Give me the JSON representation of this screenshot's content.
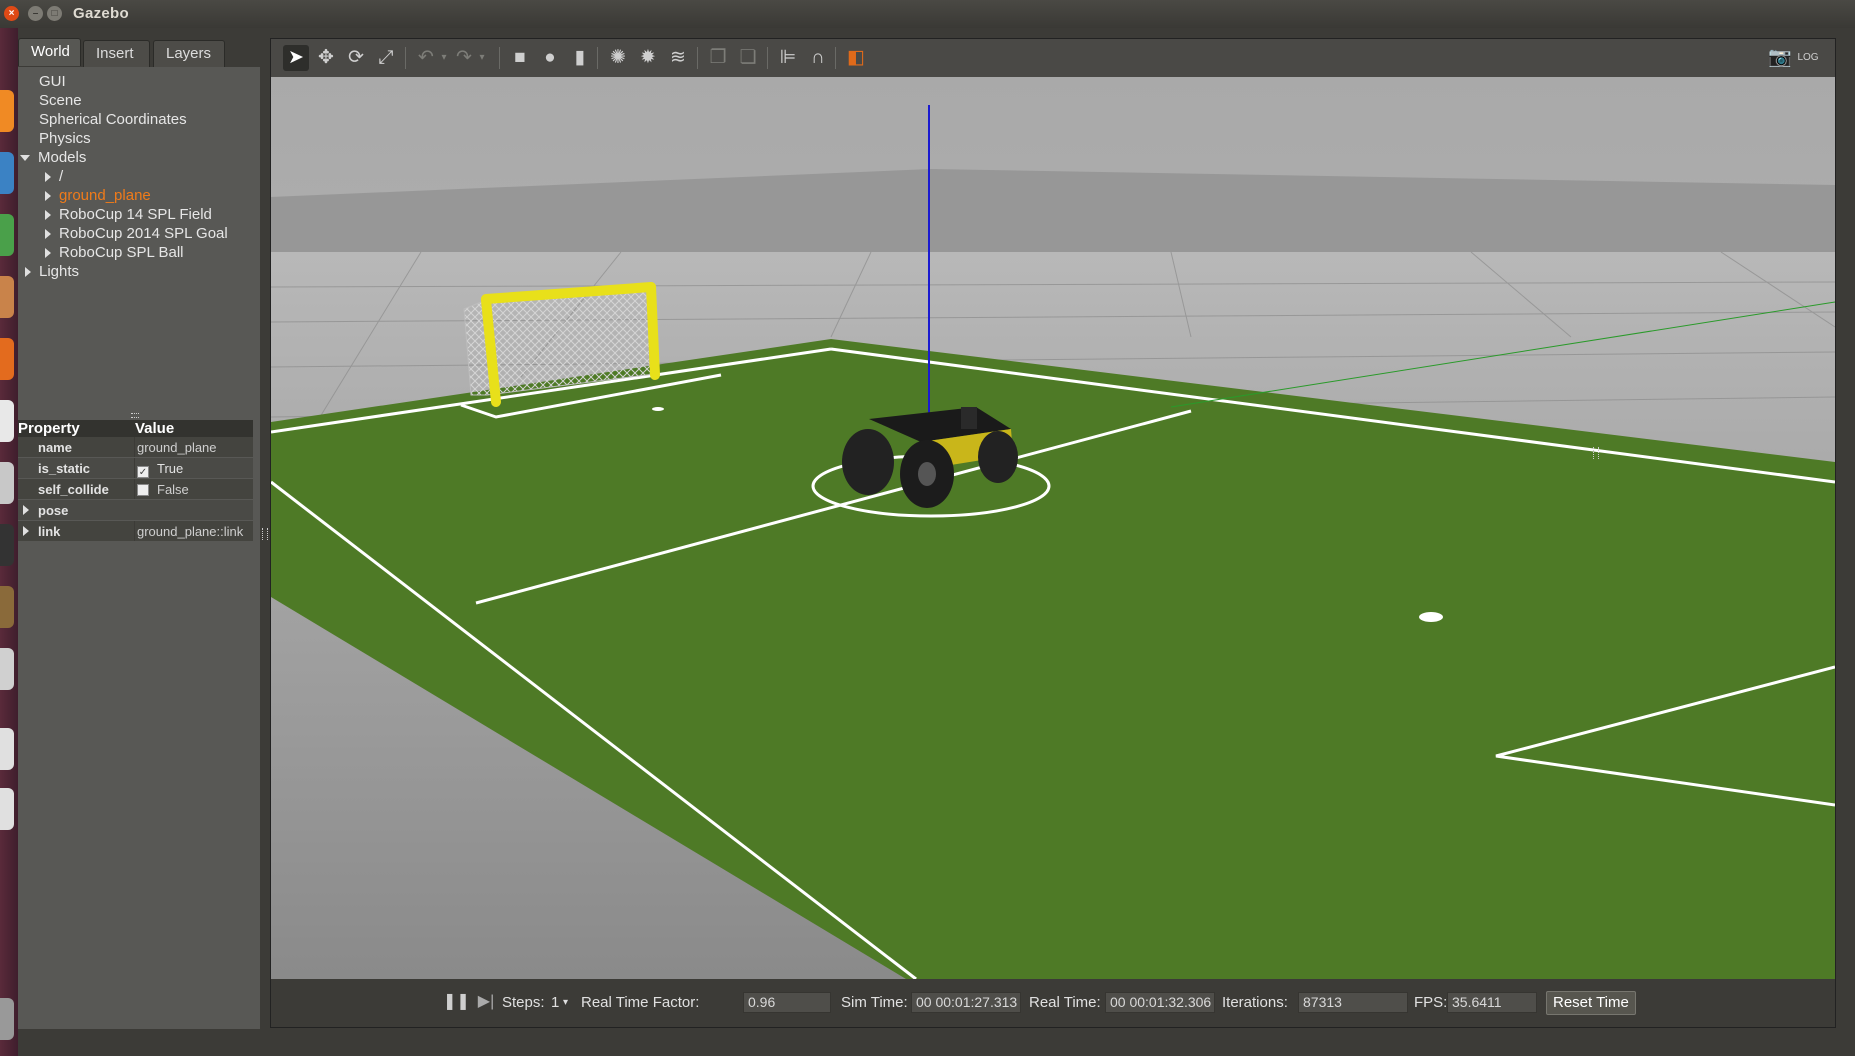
{
  "window": {
    "title": "Gazebo"
  },
  "tabs": [
    {
      "label": "World"
    },
    {
      "label": "Insert"
    },
    {
      "label": "Layers"
    }
  ],
  "tree": {
    "items": [
      "GUI",
      "Scene",
      "Spherical Coordinates",
      "Physics"
    ],
    "models_label": "Models",
    "models": [
      "/",
      "ground_plane",
      "RoboCup 14 SPL Field",
      "RoboCup 2014 SPL Goal",
      "RoboCup SPL Ball"
    ],
    "selected_model": "ground_plane",
    "lights_label": "Lights"
  },
  "properties": {
    "header_property": "Property",
    "header_value": "Value",
    "rows": [
      {
        "key": "name",
        "value": "ground_plane"
      },
      {
        "key": "is_static",
        "value": "True",
        "checked": true
      },
      {
        "key": "self_collide",
        "value": "False",
        "checked": false
      },
      {
        "key": "pose",
        "value": ""
      },
      {
        "key": "link",
        "value": "ground_plane::link"
      }
    ]
  },
  "toolbar": {
    "icons": [
      "select-mode-icon",
      "translate-icon",
      "rotate-icon",
      "scale-icon",
      "undo-icon",
      "redo-icon",
      "box-icon",
      "sphere-icon",
      "cylinder-icon",
      "point-light-icon",
      "spot-light-icon",
      "directional-light-icon",
      "copy-icon",
      "paste-icon",
      "align-icon",
      "snap-icon",
      "view-angle-icon",
      "screenshot-icon",
      "log-icon"
    ]
  },
  "status": {
    "steps_label": "Steps:",
    "steps_value": "1",
    "rtf_label": "Real Time Factor:",
    "rtf_value": "0.96",
    "sim_time_label": "Sim Time:",
    "sim_time_value": "00 00:01:27.313",
    "real_time_label": "Real Time:",
    "real_time_value": "00 00:01:32.306",
    "iterations_label": "Iterations:",
    "iterations_value": "87313",
    "fps_label": "FPS:",
    "fps_value": "35.6411",
    "reset_label": "Reset Time"
  },
  "colors": {
    "selected": "#f07b1a",
    "field": "#4e7a26",
    "goal": "#e8e01a"
  }
}
